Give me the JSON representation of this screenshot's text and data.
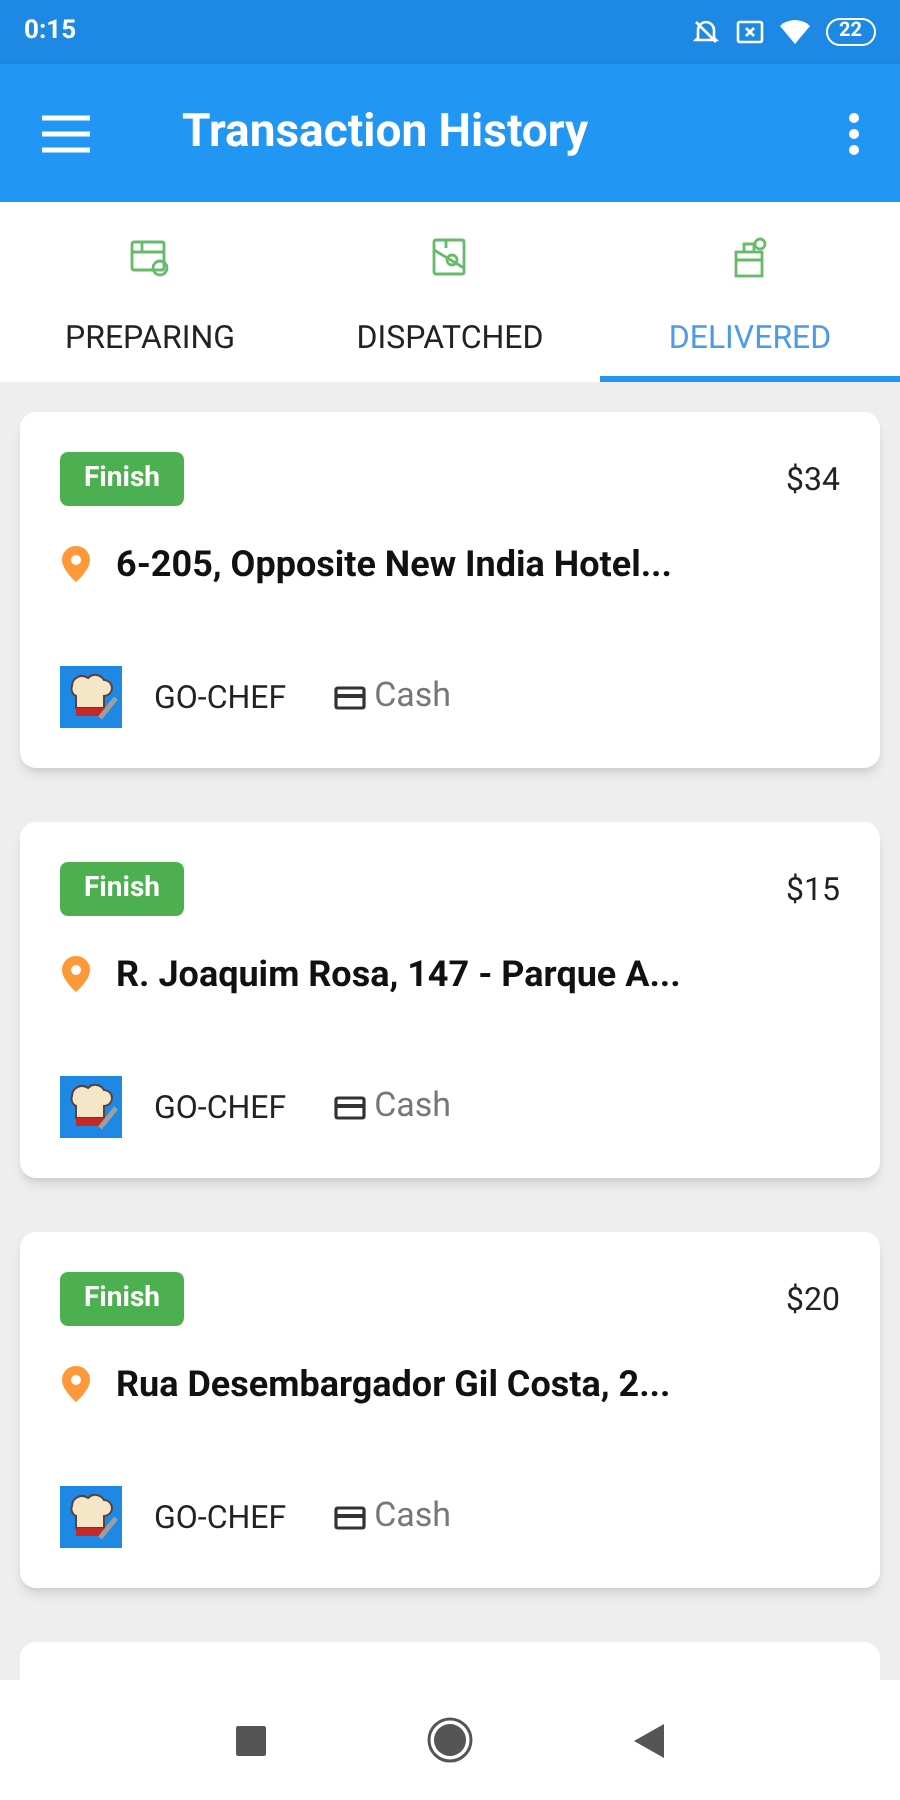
{
  "status_bar": {
    "time": "0:15",
    "battery": "22"
  },
  "app_bar": {
    "title": "Transaction History"
  },
  "tabs": [
    {
      "label": "PREPARING",
      "selected": false
    },
    {
      "label": "DISPATCHED",
      "selected": false
    },
    {
      "label": "DELIVERED",
      "selected": true
    }
  ],
  "orders": [
    {
      "status": "Finish",
      "price": "$34",
      "address": "6-205, Opposite New India Hotel...",
      "restaurant": "GO-CHEF",
      "payment": "Cash"
    },
    {
      "status": "Finish",
      "price": "$15",
      "address": "R. Joaquim Rosa, 147 - Parque A...",
      "restaurant": "GO-CHEF",
      "payment": "Cash"
    },
    {
      "status": "Finish",
      "price": "$20",
      "address": "Rua Desembargador Gil Costa, 2...",
      "restaurant": "GO-CHEF",
      "payment": "Cash"
    }
  ]
}
